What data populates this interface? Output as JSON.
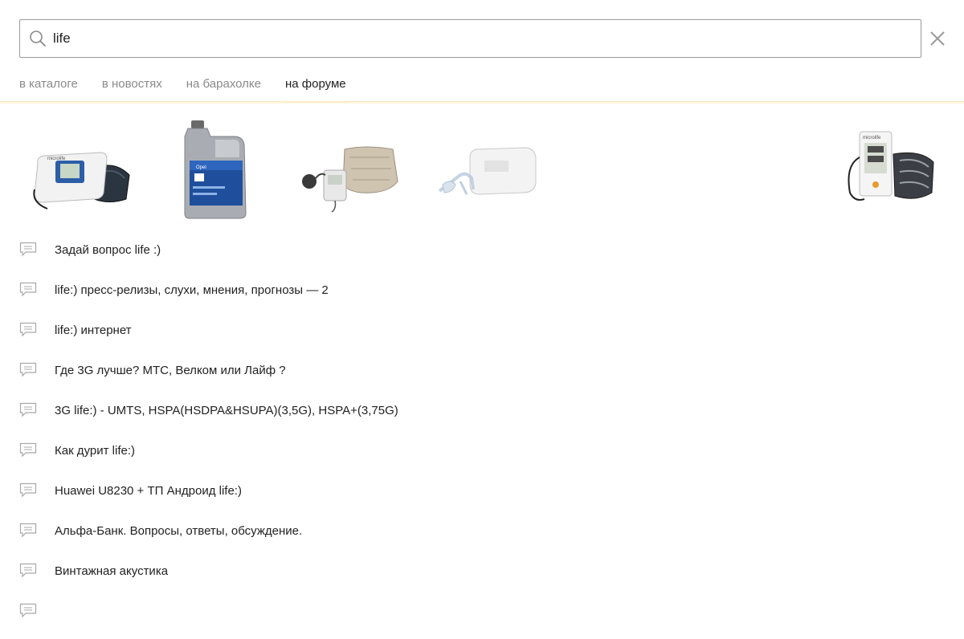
{
  "search": {
    "value": "life",
    "search_icon": "search-icon",
    "close_icon": "close-icon"
  },
  "tabs": [
    {
      "label": "в каталоге",
      "active": false
    },
    {
      "label": "в новостях",
      "active": false
    },
    {
      "label": "на барахолке",
      "active": false
    },
    {
      "label": "на форуме",
      "active": true
    }
  ],
  "products": [
    {
      "kind": "blood-pressure-monitor",
      "icon": "blood-pressure-monitor-icon",
      "brand_label": "microlife"
    },
    {
      "kind": "motor-oil-canister",
      "icon": "motor-oil-canister-icon",
      "brand_label": "Opel"
    },
    {
      "kind": "mechanical-tonometer",
      "icon": "mechanical-tonometer-icon"
    },
    {
      "kind": "nebulizer",
      "icon": "nebulizer-icon"
    },
    {
      "kind": "blood-pressure-monitor",
      "icon": "blood-pressure-monitor-icon",
      "brand_label": "microlife"
    }
  ],
  "forum_topics": [
    {
      "title": "Задай вопрос life :)",
      "icon": "comment-icon"
    },
    {
      "title": "life:) пресс-релизы, слухи, мнения, прогнозы — 2",
      "icon": "comment-icon"
    },
    {
      "title": "life:) интернет",
      "icon": "comment-icon"
    },
    {
      "title": "Где 3G лучше? МТС, Велком или Лайф ?",
      "icon": "comment-icon"
    },
    {
      "title": "3G life:) - UMTS, HSPA(HSDPA&HSUPA)(3,5G), HSPA+(3,75G)",
      "icon": "comment-icon"
    },
    {
      "title": "Как дурит life:)",
      "icon": "comment-icon"
    },
    {
      "title": "Huawei U8230 + ТП Андроид life:)",
      "icon": "comment-icon"
    },
    {
      "title": "Альфа-Банк. Вопросы, ответы, обсуждение.",
      "icon": "comment-icon"
    },
    {
      "title": "Винтажная акустика",
      "icon": "comment-icon"
    },
    {
      "title": "",
      "icon": "comment-icon"
    }
  ],
  "colors": {
    "accent": "#f7c64a",
    "text": "#222222",
    "muted": "#8a8a8a",
    "border": "#9a9a9a"
  }
}
